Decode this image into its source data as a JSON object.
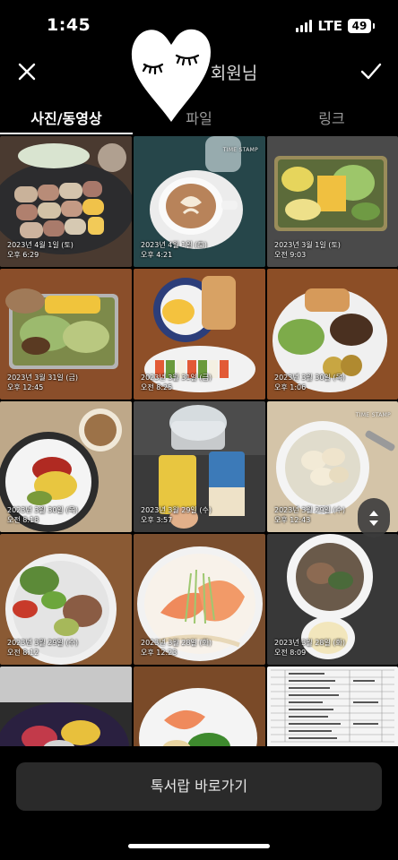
{
  "status": {
    "time": "1:45",
    "network": "LTE",
    "battery": "49"
  },
  "header": {
    "title_visible": "회원님",
    "close_icon": "close-icon",
    "confirm_icon": "check-icon"
  },
  "tabs": [
    {
      "label": "사진/동영상",
      "active": true
    },
    {
      "label": "파일",
      "active": false
    },
    {
      "label": "링크",
      "active": false
    }
  ],
  "photo_brand": "TIME STAMP",
  "photos": [
    {
      "date": "2023년 4월 1일 (토)",
      "time": "오후 6:29"
    },
    {
      "date": "2023년 4월 1일 (토)",
      "time": "오후 4:21"
    },
    {
      "date": "2023년 3월 1일 (토)",
      "time": "오전 9:03"
    },
    {
      "date": "2023년 3월 31일 (금)",
      "time": "오후 12:45"
    },
    {
      "date": "2023년 3월 31일 (금)",
      "time": "오전 8:25"
    },
    {
      "date": "2023년 3월 30일 (목)",
      "time": "오후 1:06"
    },
    {
      "date": "2023년 3월 30일 (목)",
      "time": "오전 8:18"
    },
    {
      "date": "2023년 3월 29일 (수)",
      "time": "오후 3:57"
    },
    {
      "date": "2023년 3월 29일 (수)",
      "time": "오후 12:43"
    },
    {
      "date": "2023년 3월 29일 (수)",
      "time": "오전 8:12"
    },
    {
      "date": "2023년 3월 28일 (화)",
      "time": "오후 12:23"
    },
    {
      "date": "2023년 3월 28일 (화)",
      "time": "오전 8:09"
    },
    {
      "date": "",
      "time": ""
    },
    {
      "date": "",
      "time": ""
    },
    {
      "date": "",
      "time": ""
    }
  ],
  "bottom": {
    "shortcut_label": "톡서랍 바로가기"
  }
}
